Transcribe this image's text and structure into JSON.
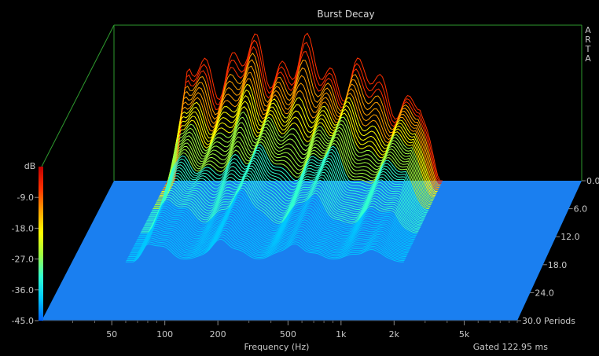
{
  "chart_data": {
    "type": "waterfall",
    "title": "Burst Decay",
    "brand": "ARTA",
    "xlabel": "Frequency (Hz)",
    "footer": "Gated 122.95 ms",
    "x_scale": "log",
    "x_range_hz": [
      20,
      10000
    ],
    "x_ticks": [
      {
        "value": 50,
        "label": "50"
      },
      {
        "value": 100,
        "label": "100"
      },
      {
        "value": 200,
        "label": "200"
      },
      {
        "value": 500,
        "label": "500"
      },
      {
        "value": 1000,
        "label": "1k"
      },
      {
        "value": 2000,
        "label": "2k"
      },
      {
        "value": 5000,
        "label": "5k"
      }
    ],
    "x_minor_ticks": [
      30,
      40,
      60,
      70,
      80,
      90,
      300,
      400,
      600,
      700,
      800,
      900,
      3000,
      4000,
      6000,
      7000,
      8000,
      9000,
      10000
    ],
    "z_axis_unit": "Periods",
    "z_range": [
      0,
      30
    ],
    "z_ticks": [
      "0.0",
      "6.0",
      "12.0",
      "18.0",
      "24.0",
      "30.0"
    ],
    "y_axis_unit": "dB",
    "y_range_db": [
      -45,
      0
    ],
    "y_ticks": [
      "-9.0",
      "-18.0",
      "-27.0",
      "-36.0",
      "-45.0"
    ],
    "slice_count": 62,
    "responded_band_hz": [
      45,
      1500
    ],
    "level_colors": [
      "#0060ff",
      "#00c8ff",
      "#30ffd0",
      "#a0ff40",
      "#ffff00",
      "#ffa000",
      "#ff3000",
      "#c00000"
    ],
    "floor_color": "#1a7ff0",
    "frame_color": "#2e9a2e"
  }
}
